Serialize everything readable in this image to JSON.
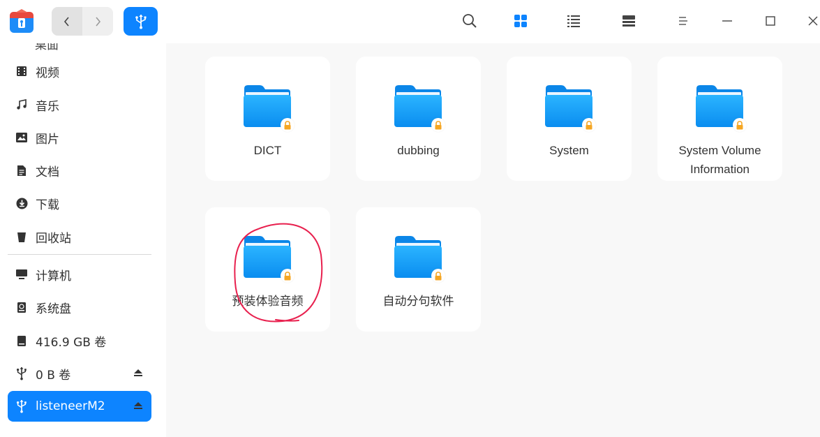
{
  "sidebar": {
    "cut_off_label": "桌面",
    "items": [
      {
        "label": "视频",
        "icon": "video-icon"
      },
      {
        "label": "音乐",
        "icon": "music-icon"
      },
      {
        "label": "图片",
        "icon": "picture-icon"
      },
      {
        "label": "文档",
        "icon": "document-icon"
      },
      {
        "label": "下载",
        "icon": "download-icon"
      },
      {
        "label": "回收站",
        "icon": "trash-icon"
      },
      {
        "label": "计算机",
        "icon": "computer-icon"
      },
      {
        "label": "系统盘",
        "icon": "system-disk-icon"
      },
      {
        "label": "416.9 GB 卷",
        "icon": "drive-icon"
      },
      {
        "label": "0 B 卷",
        "icon": "usb-icon"
      },
      {
        "label": "listeneerM2",
        "icon": "usb-icon"
      }
    ]
  },
  "files": [
    {
      "name": "DICT",
      "icon": "folder-icon",
      "locked": true
    },
    {
      "name": "dubbing",
      "icon": "folder-icon",
      "locked": true
    },
    {
      "name": "System",
      "icon": "folder-icon",
      "locked": true
    },
    {
      "name": "System Volume Information",
      "icon": "folder-icon",
      "locked": true
    },
    {
      "name": "预装体验音频",
      "icon": "folder-icon",
      "locked": true
    },
    {
      "name": "自动分句软件",
      "icon": "folder-icon",
      "locked": true
    }
  ],
  "toolbar": {
    "icons": [
      "search-icon",
      "icon-view-icon",
      "list-view-icon",
      "tree-view-icon",
      "menu-icon",
      "minimize-icon",
      "maximize-icon",
      "close-icon"
    ]
  },
  "colors": {
    "accent": "#0d84ff",
    "folder": "#1aa3ff",
    "lock": "#f5a623",
    "annotation": "#e8204e"
  }
}
